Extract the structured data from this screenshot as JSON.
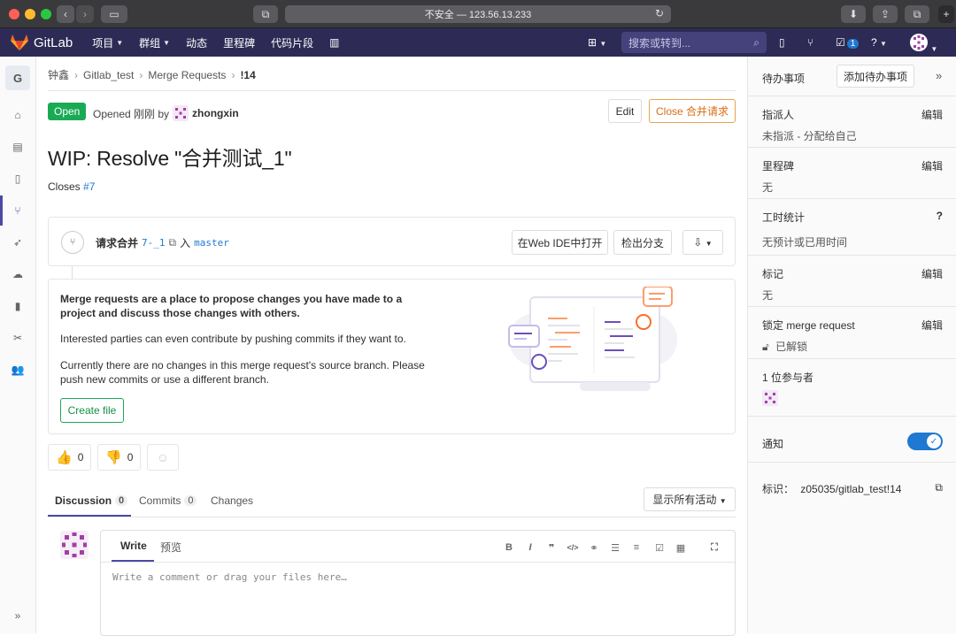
{
  "browser": {
    "url": "不安全 — 123.56.13.233"
  },
  "nav": {
    "brand": "GitLab",
    "items": [
      "项目",
      "群组",
      "动态",
      "里程碑",
      "代码片段"
    ],
    "search_placeholder": "搜索或转到...",
    "mr_count": "1"
  },
  "left_sidebar": {
    "project_initial": "G"
  },
  "breadcrumb": {
    "items": [
      "钟鑫",
      "Gitlab_test",
      "Merge Requests",
      "!14"
    ]
  },
  "mr": {
    "status": "Open",
    "opened_prefix": "Opened 刚刚 by",
    "author": "zhongxin",
    "edit_label": "Edit",
    "close_label": "Close 合并请求",
    "title": "WIP: Resolve \"合并测试_1\"",
    "closes_prefix": "Closes",
    "closes_issue": "#7"
  },
  "widget": {
    "request_merge": "请求合并",
    "source_branch": "7-_1",
    "into": "入",
    "target_branch": "master",
    "open_ide": "在Web IDE中打开",
    "checkout": "检出分支"
  },
  "empty_state": {
    "heading": "Merge requests are a place to propose changes you have made to a project and discuss those changes with others.",
    "line2": "Interested parties can even contribute by pushing commits if they want to.",
    "line3": "Currently there are no changes in this merge request's source branch. Please push new commits or use a different branch.",
    "create_file": "Create file"
  },
  "awards": {
    "thumbsup": "0",
    "thumbsdown": "0"
  },
  "tabs": {
    "discussion": "Discussion",
    "discussion_count": "0",
    "commits": "Commits",
    "commits_count": "0",
    "changes": "Changes",
    "filter": "显示所有活动"
  },
  "comment": {
    "write": "Write",
    "preview": "预览",
    "placeholder": "Write a comment or drag your files here…"
  },
  "right_sidebar": {
    "todo_label": "待办事项",
    "todo_button": "添加待办事项",
    "assignee_label": "指派人",
    "assignee_value": "未指派 - 分配给自己",
    "milestone_label": "里程碑",
    "milestone_value": "无",
    "time_label": "工时统计",
    "time_value": "无预计或已用时间",
    "labels_label": "标记",
    "labels_value": "无",
    "lock_label": "锁定 merge request",
    "lock_value": "已解锁",
    "participants_label": "1 位参与者",
    "notify_label": "通知",
    "reference_label": "标识：",
    "reference_value": "z05035/gitlab_test!14",
    "edit": "编辑"
  },
  "colors": {
    "nav": "#2d2b55",
    "open": "#1aaa55",
    "link": "#1f78d1",
    "close": "#d96d12"
  }
}
